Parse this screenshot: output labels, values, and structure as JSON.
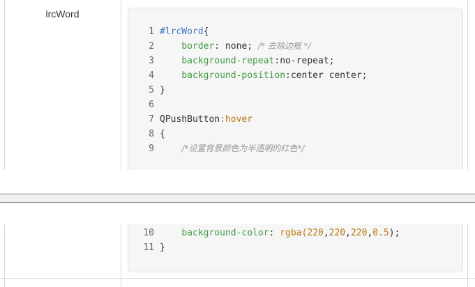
{
  "table": {
    "name": "lrcWord"
  },
  "code": {
    "lines": [
      {
        "n": "1",
        "tokens": [
          {
            "t": "#lrcWord",
            "c": "id"
          },
          {
            "t": "{",
            "c": "plain"
          }
        ]
      },
      {
        "n": "2",
        "tokens": [
          {
            "t": "    ",
            "c": "plain"
          },
          {
            "t": "border",
            "c": "prop"
          },
          {
            "t": ": none; ",
            "c": "plain"
          },
          {
            "t": "/* 去除边框 */",
            "c": "cmt"
          }
        ]
      },
      {
        "n": "3",
        "tokens": [
          {
            "t": "    ",
            "c": "plain"
          },
          {
            "t": "background-repeat",
            "c": "prop"
          },
          {
            "t": ":no-repeat;",
            "c": "plain"
          }
        ]
      },
      {
        "n": "4",
        "tokens": [
          {
            "t": "    ",
            "c": "plain"
          },
          {
            "t": "background-position",
            "c": "prop"
          },
          {
            "t": ":center center;",
            "c": "plain"
          }
        ]
      },
      {
        "n": "5",
        "tokens": [
          {
            "t": "}",
            "c": "plain"
          }
        ]
      },
      {
        "n": "6",
        "tokens": []
      },
      {
        "n": "7",
        "tokens": [
          {
            "t": "QPushButton",
            "c": "plain"
          },
          {
            "t": ":hover",
            "c": "kw"
          }
        ]
      },
      {
        "n": "8",
        "tokens": [
          {
            "t": "{",
            "c": "plain"
          }
        ]
      },
      {
        "n": "9",
        "tokens": [
          {
            "t": "    ",
            "c": "plain"
          },
          {
            "t": "/*设置背景颜色为半透明的红色*/",
            "c": "cmt"
          }
        ]
      }
    ],
    "lines_after": [
      {
        "n": "10",
        "tokens": [
          {
            "t": "    ",
            "c": "plain"
          },
          {
            "t": "background-color",
            "c": "prop"
          },
          {
            "t": ": ",
            "c": "plain"
          },
          {
            "t": "rgba(",
            "c": "kw"
          },
          {
            "t": "220",
            "c": "num"
          },
          {
            "t": ",",
            "c": "plain"
          },
          {
            "t": "220",
            "c": "num"
          },
          {
            "t": ",",
            "c": "plain"
          },
          {
            "t": "220",
            "c": "num"
          },
          {
            "t": ",",
            "c": "plain"
          },
          {
            "t": "0.5",
            "c": "num"
          },
          {
            "t": ");",
            "c": "plain"
          }
        ]
      },
      {
        "n": "11",
        "tokens": [
          {
            "t": "}",
            "c": "plain"
          }
        ]
      }
    ]
  },
  "colors": {
    "id": "#4078c0",
    "prop": "#3f9a3f",
    "comment": "#9a9a9a",
    "keyword": "#b9770e"
  }
}
